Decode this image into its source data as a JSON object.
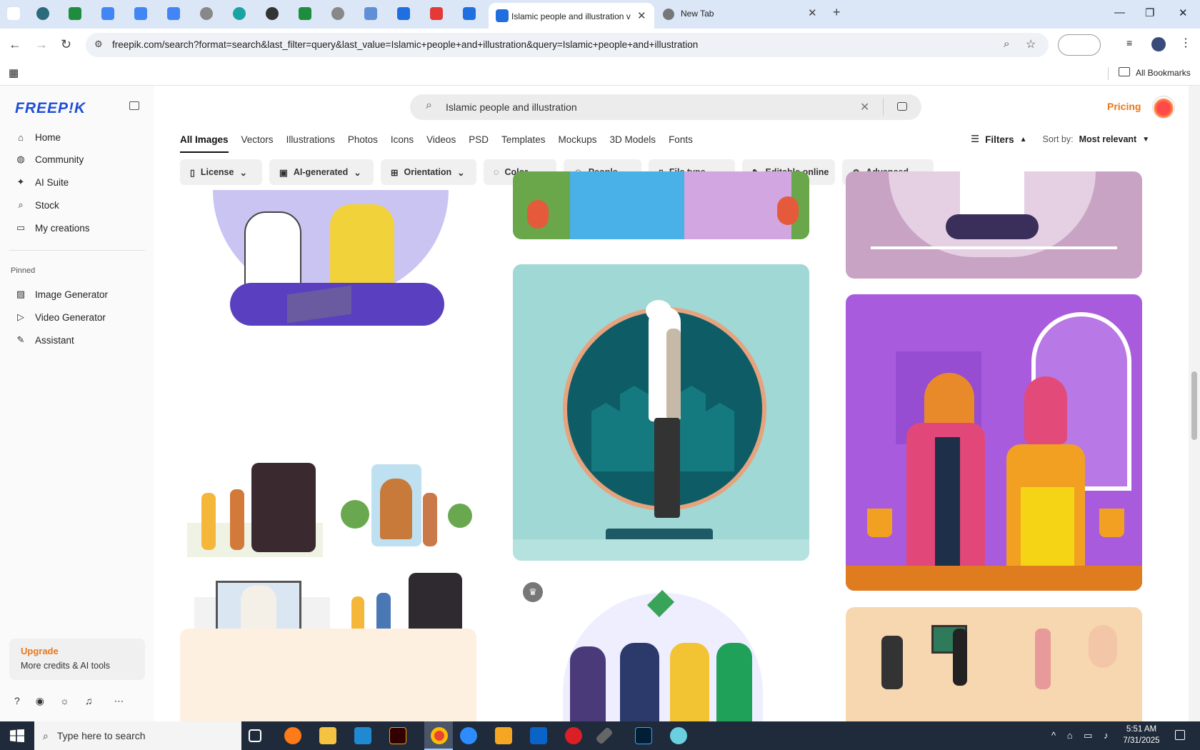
{
  "browser": {
    "active_tab_title": "Islamic people and illustration v",
    "second_tab_title": "New Tab",
    "url": "freepik.com/search?format=search&last_filter=query&last_value=Islamic+people+and+illustration&query=Islamic+people+and+illustration",
    "all_bookmarks": "All Bookmarks"
  },
  "sidebar": {
    "logo": "FREEP!K",
    "nav": [
      "Home",
      "Community",
      "AI Suite",
      "Stock",
      "My creations"
    ],
    "pinned_heading": "Pinned",
    "pinned": [
      "Image Generator",
      "Video Generator",
      "Assistant"
    ],
    "upgrade_title": "Upgrade",
    "upgrade_sub": "More credits & AI tools"
  },
  "search": {
    "query": "Islamic people and illustration"
  },
  "header": {
    "pricing": "Pricing"
  },
  "content_tabs": [
    "All Images",
    "Vectors",
    "Illustrations",
    "Photos",
    "Icons",
    "Videos",
    "PSD",
    "Templates",
    "Mockups",
    "3D Models",
    "Fonts"
  ],
  "filters_label": "Filters",
  "sort_label": "Sort by:",
  "sort_value": "Most relevant",
  "chips": [
    "License",
    "AI-generated",
    "Orientation",
    "Color",
    "People",
    "File type",
    "Editable online",
    "Advanced"
  ],
  "taskbar": {
    "search_placeholder": "Type here to search",
    "time": "5:51 AM",
    "date": "7/31/2025"
  },
  "colors": {
    "brand": "#1d4ed8",
    "pricing": "#e8781c",
    "upgrade": "#e8781c"
  }
}
